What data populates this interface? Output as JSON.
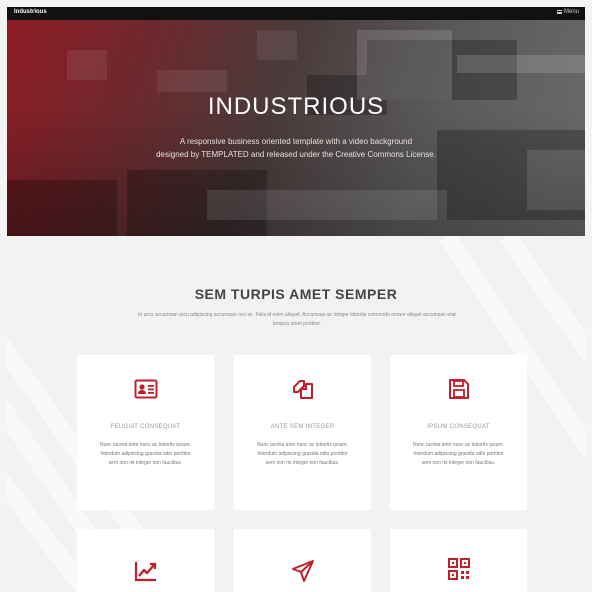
{
  "header": {
    "brand": "Industrious",
    "menu_label": "Menu",
    "menu_icon": "hamburger-icon"
  },
  "hero": {
    "title": "INDUSTRIOUS",
    "subtitle_line1": "A responsive business oriented template with a video background",
    "subtitle_line2": "designed by TEMPLATED and released under the Creative Commons License."
  },
  "section": {
    "title": "SEM TURPIS AMET SEMPER",
    "text": "In arcu accumsan arcu adipiscing accumsan orci ac. Felis id enim aliquet. Accumsan ac integer lobortis commodo ornare aliquet accumsan erat tempus amet porttitor."
  },
  "cards": [
    {
      "icon": "id-card-icon",
      "title": "FEUGIAT CONSEQUAT",
      "text": "Nunc lacinia ante nunc ac lobortis ipsum. Interdum adipiscing gravida odio porttitor sem non mi integer non faucibus."
    },
    {
      "icon": "copy-icon",
      "title": "ANTE SEM INTEGER",
      "text": "Nunc lacinia ante nunc ac lobortis ipsum. Interdum adipiscing gravida odio porttitor sem non mi integer non faucibus."
    },
    {
      "icon": "save-icon",
      "title": "IPSUM CONSEQUAT",
      "text": "Nunc lacinia ante nunc ac lobortis ipsum. Interdum adipiscing gravida odio porttitor sem non mi integer non faucibus."
    },
    {
      "icon": "chart-line-icon",
      "title": "",
      "text": ""
    },
    {
      "icon": "paper-plane-icon",
      "title": "",
      "text": ""
    },
    {
      "icon": "qrcode-icon",
      "title": "",
      "text": ""
    }
  ],
  "colors": {
    "accent": "#c0202b",
    "topbar": "#111111"
  }
}
